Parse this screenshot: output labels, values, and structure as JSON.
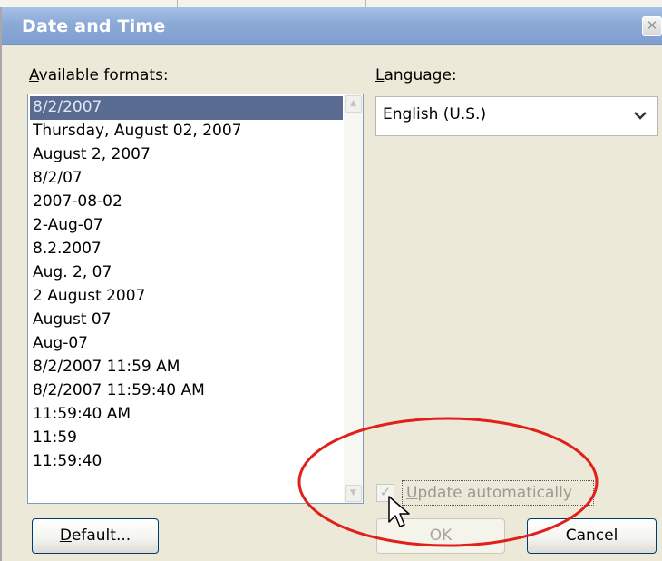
{
  "dialog": {
    "title": "Date and Time",
    "close_icon": "close-icon"
  },
  "formats": {
    "label": "Available formats:",
    "label_accel": "A",
    "label_rest": "vailable formats:",
    "items": [
      "8/2/2007",
      "Thursday, August 02, 2007",
      "August 2, 2007",
      "8/2/07",
      "2007-08-02",
      "2-Aug-07",
      "8.2.2007",
      "Aug. 2, 07",
      "2 August 2007",
      "August 07",
      "Aug-07",
      "8/2/2007 11:59 AM",
      "8/2/2007 11:59:40 AM",
      "11:59:40 AM",
      "11:59",
      "11:59:40"
    ],
    "selected_index": 0
  },
  "language": {
    "label": "Language:",
    "label_accel": "L",
    "label_rest": "anguage:",
    "value": "English (U.S.)",
    "arrow_icon": "chevron-down-icon"
  },
  "update": {
    "label": "Update automatically",
    "label_accel": "U",
    "label_rest": "pdate automatically",
    "checked": true,
    "disabled": true
  },
  "buttons": {
    "default_label": "Default...",
    "default_accel": "D",
    "default_rest": "efault...",
    "ok_label": "OK",
    "cancel_label": "Cancel"
  },
  "colors": {
    "title_bar": "#8ba9d6",
    "selection": "#5a6b91",
    "annotation": "#e0201a"
  }
}
